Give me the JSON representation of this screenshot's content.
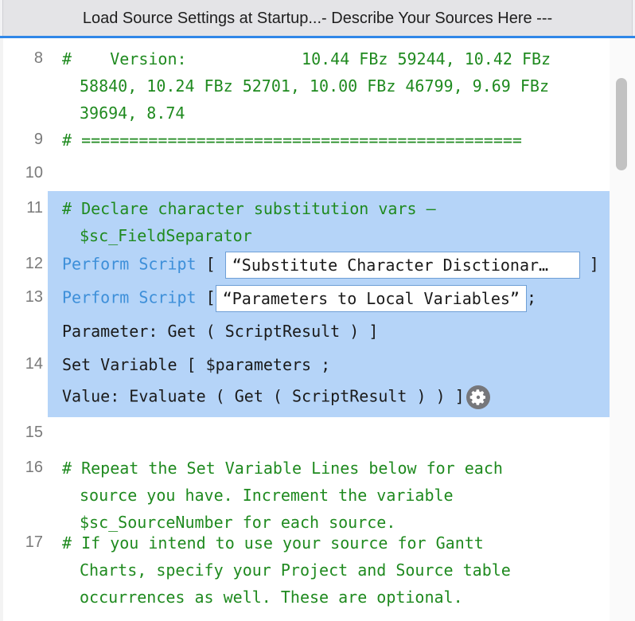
{
  "window": {
    "title": "Load Source Settings at Startup...- Describe Your Sources Here ---"
  },
  "lines": {
    "l8": {
      "num": "8",
      "hash": "#",
      "text": "    Version:            10.44 FBz 59244, 10.42 FBz",
      "cont1": "58840, 10.24 FBz 52701, 10.00 FBz 46799, 9.69 FBz",
      "cont2": "39694, 8.74"
    },
    "l9": {
      "num": "9",
      "text": "# =============================================="
    },
    "l10": {
      "num": "10"
    },
    "l11": {
      "num": "11",
      "hash": "#",
      "text": "Declare character substitution vars –",
      "cont1": "$sc_FieldSeparator"
    },
    "l12": {
      "num": "12",
      "kw1": "Perform",
      "kw2": "Script",
      "open": "[",
      "param": "“Substitute Character Disctionar…",
      "close": "]"
    },
    "l13": {
      "num": "13",
      "kw1": "Perform",
      "kw2": "Script",
      "open": "[",
      "param": "“Parameters to Local Variables”",
      "semi": ";",
      "sub": "Parameter: Get ( ScriptResult ) ]"
    },
    "l14": {
      "num": "14",
      "text": "Set Variable [ $parameters ;",
      "sub": "Value: Evaluate ( Get ( ScriptResult ) ) ]"
    },
    "l15": {
      "num": "15"
    },
    "l16": {
      "num": "16",
      "hash": "#",
      "text": "Repeat the Set Variable Lines below for each",
      "cont1": "source you have. Increment the variable",
      "cont2": "$sc_SourceNumber for each source."
    },
    "l17": {
      "num": "17",
      "hash": "#",
      "text": "If you intend to use your source for Gantt",
      "cont1": "Charts, specify your Project and Source table",
      "cont2": "occurrences as well. These are optional."
    }
  },
  "colors": {
    "comment": "#1f8a1f",
    "keyword": "#3d8fd9",
    "selection": "#b5d4f8",
    "accent": "#2f87e8"
  },
  "icons": {
    "gear": "gear-icon"
  }
}
